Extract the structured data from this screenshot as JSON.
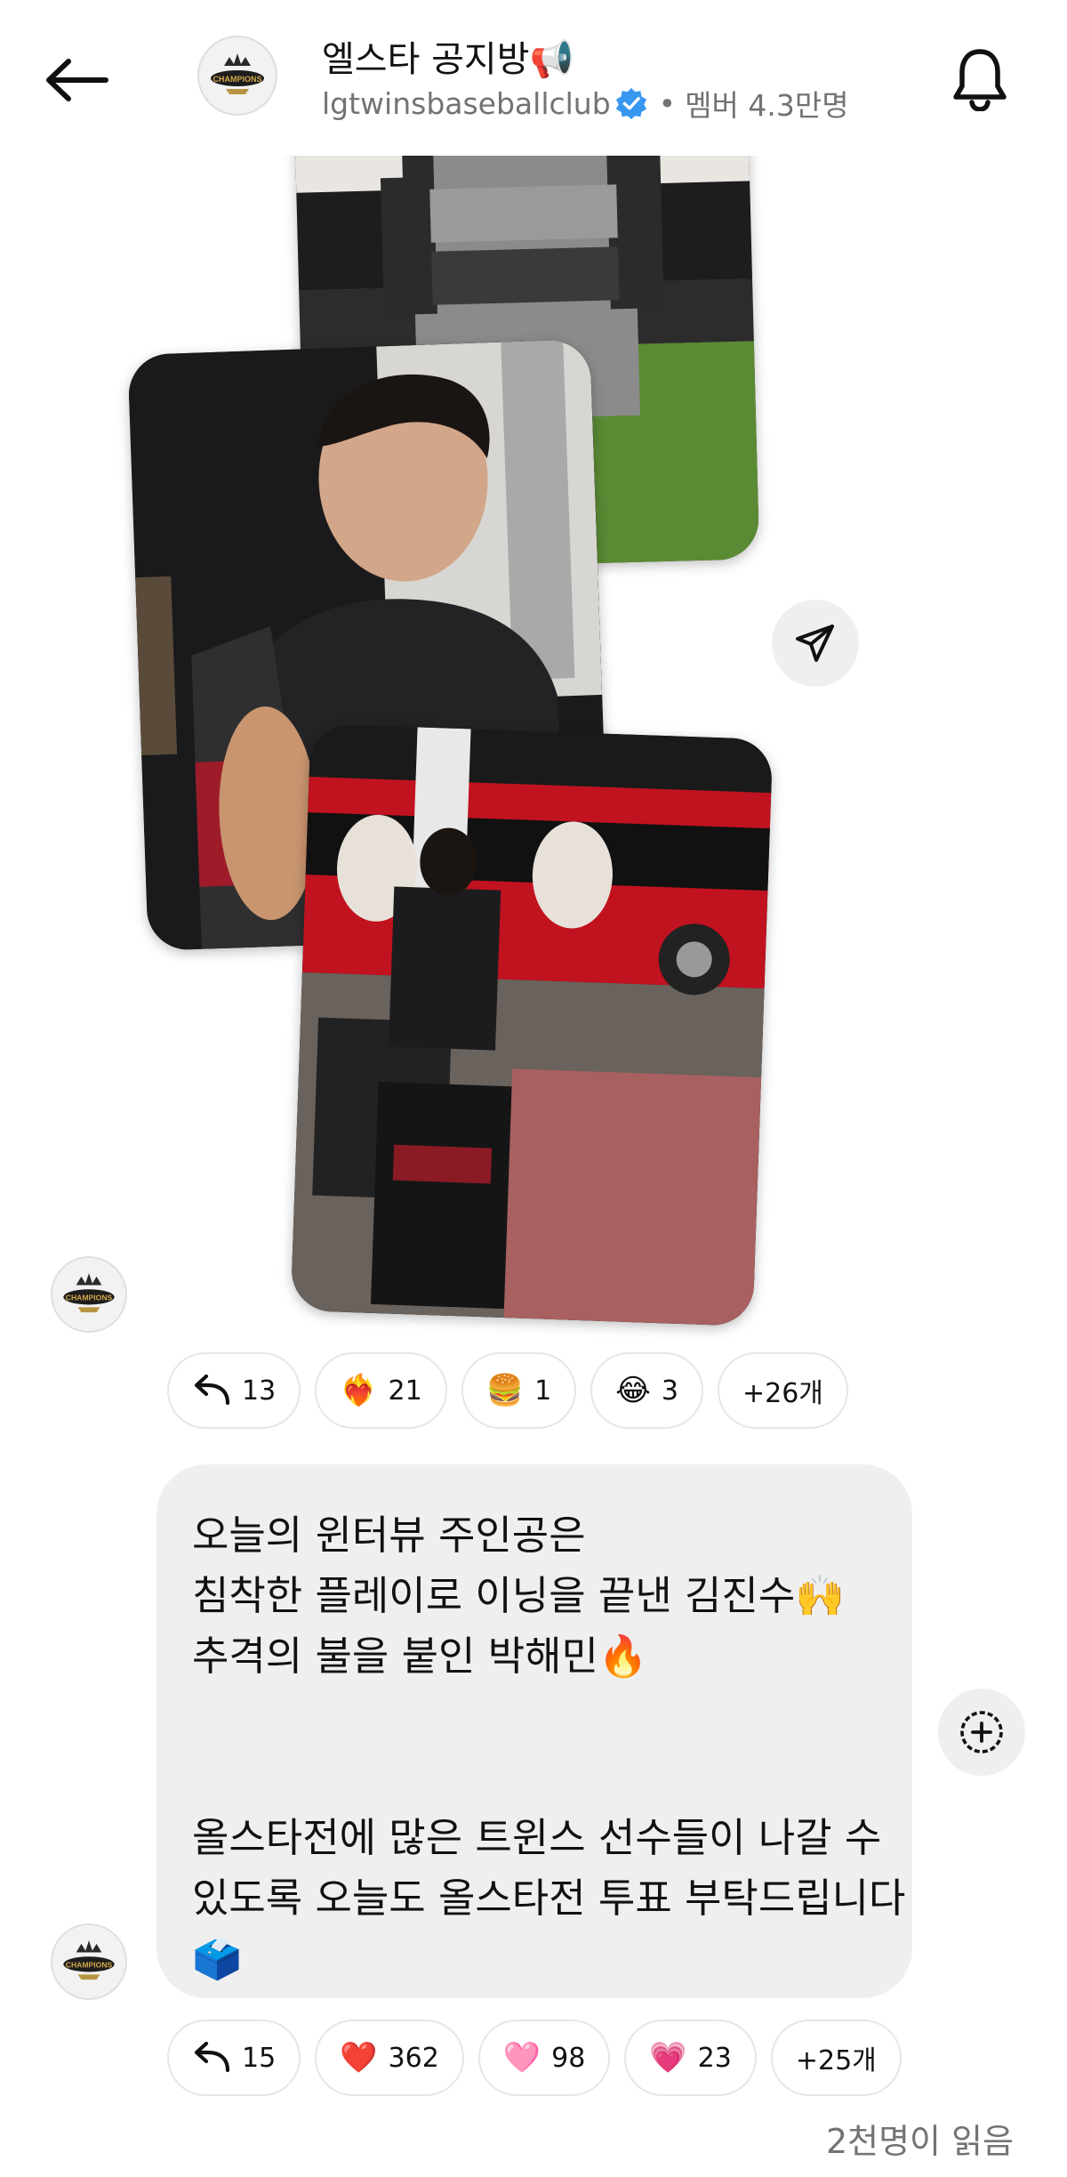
{
  "header": {
    "channel_title": "엘스타 공지방📢",
    "account_name": "lgtwinsbaseballclub",
    "separator": "•",
    "members": "멤버 4.3만명",
    "avatar_text": "CHAMPIONS"
  },
  "photo_post": {
    "reactions": [
      {
        "icon": "reply-icon",
        "count": "13"
      },
      {
        "emoji": "❤️‍🔥",
        "count": "21"
      },
      {
        "emoji": "🍔",
        "count": "1"
      },
      {
        "emoji": "😂",
        "count": "3"
      },
      {
        "label": "+26개"
      }
    ]
  },
  "text_post": {
    "lines": [
      "오늘의 윈터뷰 주인공은",
      "침착한 플레이로 이닝을 끝낸 김진수🙌",
      "추격의 불을 붙인 박해민🔥",
      "올스타전에 많은 트윈스 선수들이 나갈 수",
      "있도록 오늘도 올스타전 투표 부탁드립니다",
      "🗳️"
    ],
    "reactions": [
      {
        "icon": "reply-icon",
        "count": "15"
      },
      {
        "emoji": "❤️",
        "count": "362"
      },
      {
        "emoji": "🩷",
        "count": "98"
      },
      {
        "emoji": "💗",
        "count": "23"
      },
      {
        "label": "+25개"
      }
    ]
  },
  "footer": {
    "read_count": "2천명이 읽음"
  },
  "colors": {
    "bubble_bg": "#efefef",
    "verified_blue": "#3897f0",
    "muted_text": "#737373"
  }
}
